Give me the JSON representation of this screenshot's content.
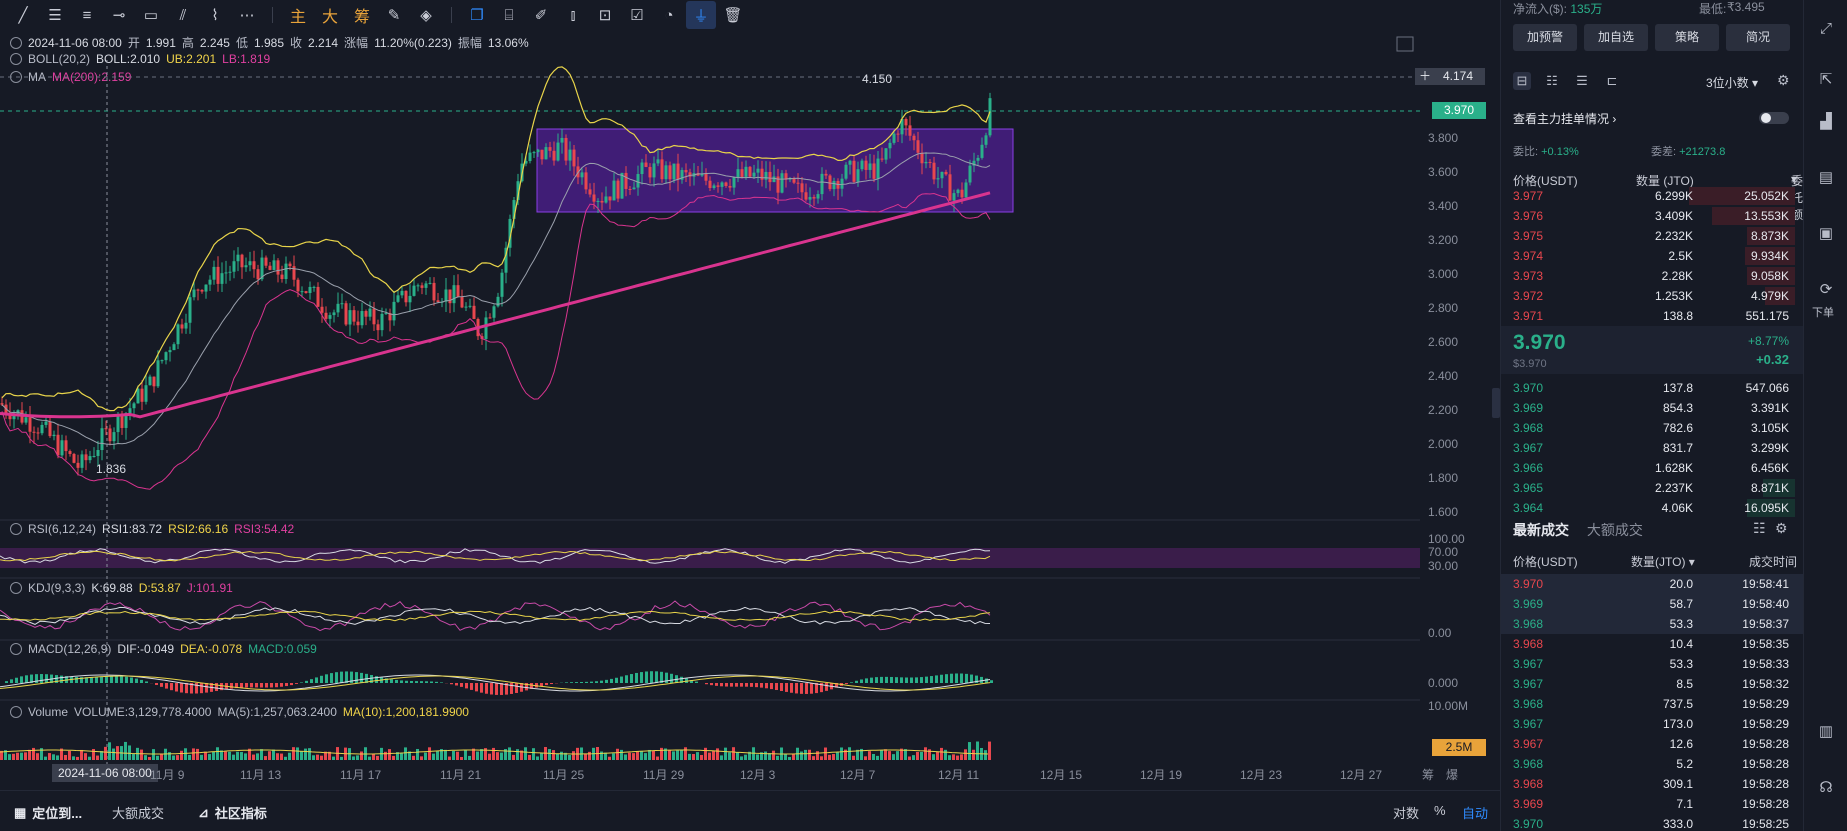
{
  "toolbar": {
    "icons": [
      "line-tool-icon",
      "hlines-tool-icon",
      "parallel-tool-icon",
      "ray-tool-icon",
      "rect-tool-icon",
      "fib-tool-icon",
      "brush-tool-icon",
      "more-tools-icon"
    ],
    "indicators": [
      "主",
      "大",
      "筹"
    ],
    "right_icons": [
      "edit-icon",
      "layers-icon",
      "ruler-icon",
      "pen-icon",
      "candle-icon",
      "lock-icon",
      "note-icon",
      "magnet-icon",
      "filter-icon",
      "trash-icon"
    ]
  },
  "header": {
    "date": "2024-11-06 08:00",
    "open_label": "开",
    "open": "1.991",
    "high_label": "高",
    "high": "2.245",
    "low_label": "低",
    "low": "1.985",
    "close_label": "收",
    "close": "2.214",
    "change_label": "涨幅",
    "change": "11.20%(0.223)",
    "amp_label": "振幅",
    "amp": "13.06%",
    "boll_name": "BOLL(20,2)",
    "boll_mid": "BOLL:2.010",
    "boll_ub": "UB:2.201",
    "boll_lb": "LB:1.819",
    "ma_name": "MA",
    "ma_val": "MA(200):2.159"
  },
  "indicators": {
    "rsi_name": "RSI(6,12,24)",
    "rsi1": "RSI1:83.72",
    "rsi2": "RSI2:66.16",
    "rsi3": "RSI3:54.42",
    "kdj_name": "KDJ(9,3,3)",
    "k": "K:69.88",
    "d": "D:53.87",
    "j": "J:101.91",
    "macd_name": "MACD(12,26,9)",
    "dif": "DIF:-0.049",
    "dea": "DEA:-0.078",
    "macd": "MACD:0.059",
    "vol_name": "Volume",
    "vol": "VOLUME:3,129,778.4000",
    "ma5": "MA(5):1,257,063.2400",
    "ma10": "MA(10):1,200,181.9900"
  },
  "price_axis": {
    "labels": [
      "3.800",
      "3.600",
      "3.400",
      "3.200",
      "3.000",
      "2.800",
      "2.600",
      "2.400",
      "2.200",
      "2.000",
      "1.800",
      "1.600"
    ],
    "tag_high": "4.174",
    "tag_current": "3.970",
    "rsi_labels": [
      "100.00",
      "70.00",
      "30.00"
    ],
    "kdj_label": "0.00",
    "macd_label": "0.000",
    "vol_label": "10.00M",
    "vol_tag": "2.5M",
    "peak_label": "4.150",
    "low_label": "1.836"
  },
  "time_axis": {
    "cursor": "2024-11-06 08:00",
    "labels": [
      "11月 9",
      "11月 13",
      "11月 17",
      "11月 21",
      "11月 25",
      "11月 29",
      "12月 3",
      "12月 7",
      "12月 11",
      "12月 15",
      "12月 19",
      "12月 23",
      "12月 27"
    ],
    "right": [
      "筹",
      "爆"
    ]
  },
  "bottom_bar": {
    "locate": "定位到...",
    "large": "大额成交",
    "community": "社区指标",
    "log": "对数",
    "pct": "%",
    "auto": "自动"
  },
  "panel": {
    "top_left": "净流入($):",
    "top_left_val": "135万",
    "top_right": "最低:",
    "top_right_val": "₹3.495",
    "buttons": [
      "加预警",
      "加自选",
      "策略",
      "简况"
    ],
    "decimal": "3位小数",
    "watch": "查看主力挂单情况",
    "ratio_label": "委比:",
    "ratio": "+0.13%",
    "diff_label": "委差:",
    "diff": "+21273.8",
    "ob_headers": [
      "价格(USDT)",
      "数量 (JTO)",
      "委托额"
    ],
    "asks": [
      {
        "p": "3.977",
        "q": "6.299K",
        "t": "25.052K",
        "w": 0.66
      },
      {
        "p": "3.976",
        "q": "3.409K",
        "t": "13.553K",
        "w": 0.52
      },
      {
        "p": "3.975",
        "q": "2.232K",
        "t": "8.873K",
        "w": 0.3
      },
      {
        "p": "3.974",
        "q": "2.5K",
        "t": "9.934K",
        "w": 0.31
      },
      {
        "p": "3.973",
        "q": "2.28K",
        "t": "9.058K",
        "w": 0.3
      },
      {
        "p": "3.972",
        "q": "1.253K",
        "t": "4.979K",
        "w": 0.19
      },
      {
        "p": "3.971",
        "q": "138.8",
        "t": "551.175",
        "w": 0.0
      }
    ],
    "last_price": "3.970",
    "last_sub": "$3.970",
    "last_pct": "+8.77%",
    "last_chg": "+0.32",
    "bids": [
      {
        "p": "3.970",
        "q": "137.8",
        "t": "547.066",
        "w": 0.0
      },
      {
        "p": "3.969",
        "q": "854.3",
        "t": "3.391K",
        "w": 0.0
      },
      {
        "p": "3.968",
        "q": "782.6",
        "t": "3.105K",
        "w": 0.0
      },
      {
        "p": "3.967",
        "q": "831.7",
        "t": "3.299K",
        "w": 0.0
      },
      {
        "p": "3.966",
        "q": "1.628K",
        "t": "6.456K",
        "w": 0.0
      },
      {
        "p": "3.965",
        "q": "2.237K",
        "t": "8.871K",
        "w": 0.2
      },
      {
        "p": "3.964",
        "q": "4.06K",
        "t": "16.095K",
        "w": 0.3
      }
    ],
    "trades_tab1": "最新成交",
    "trades_tab2": "大额成交",
    "trade_headers": [
      "价格(USDT)",
      "数量(JTO)",
      "成交时间"
    ],
    "trades": [
      {
        "p": "3.970",
        "q": "20.0",
        "t": "19:58:41",
        "side": "sell",
        "hl": true
      },
      {
        "p": "3.969",
        "q": "58.7",
        "t": "19:58:40",
        "side": "buy",
        "hl": true
      },
      {
        "p": "3.968",
        "q": "53.3",
        "t": "19:58:37",
        "side": "buy",
        "hl": true
      },
      {
        "p": "3.968",
        "q": "10.4",
        "t": "19:58:35",
        "side": "sell",
        "hl": false
      },
      {
        "p": "3.967",
        "q": "53.3",
        "t": "19:58:33",
        "side": "buy",
        "hl": false
      },
      {
        "p": "3.967",
        "q": "8.5",
        "t": "19:58:32",
        "side": "buy",
        "hl": false
      },
      {
        "p": "3.968",
        "q": "737.5",
        "t": "19:58:29",
        "side": "buy",
        "hl": false
      },
      {
        "p": "3.967",
        "q": "173.0",
        "t": "19:58:29",
        "side": "buy",
        "hl": false
      },
      {
        "p": "3.967",
        "q": "12.6",
        "t": "19:58:28",
        "side": "sell",
        "hl": false
      },
      {
        "p": "3.968",
        "q": "5.2",
        "t": "19:58:28",
        "side": "buy",
        "hl": false
      },
      {
        "p": "3.968",
        "q": "309.1",
        "t": "19:58:28",
        "side": "sell",
        "hl": false
      },
      {
        "p": "3.969",
        "q": "7.1",
        "t": "19:58:28",
        "side": "sell",
        "hl": false
      },
      {
        "p": "3.970",
        "q": "333.0",
        "t": "19:58:25",
        "side": "buy",
        "hl": false
      }
    ]
  },
  "sidebar": {
    "order_label": "下单"
  },
  "colors": {
    "up": "#2ab08a",
    "down": "#e8474e",
    "ma200": "#d9348f",
    "boll": "#e8d44a",
    "box": "#7b2fd6",
    "accent": "#2f8cff"
  }
}
